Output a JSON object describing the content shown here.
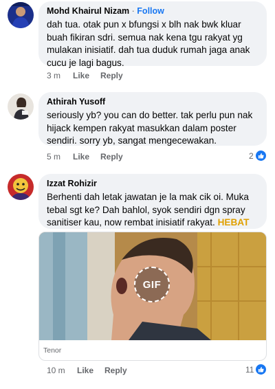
{
  "comments": [
    {
      "author": "Mohd Khairul Nizam",
      "separator": "·",
      "follow_label": "Follow",
      "text_lines": [
        "dah tua. otak pun x bfungsi x blh nak bwk kluar",
        "buah fikiran sdri. semua nak kena tgu rakyat yg",
        "mulakan inisiatif. dah tua duduk rumah jaga anak",
        "cucu je lagi bagus."
      ],
      "time": "3 m",
      "like_label": "Like",
      "reply_label": "Reply"
    },
    {
      "author": "Athirah Yusoff",
      "text_lines": [
        "seriously yb? you can do better. tak perlu pun nak",
        "hijack kempen rakyat masukkan dalam poster",
        "sendiri. sorry yb, sangat mengecewakan."
      ],
      "time": "5 m",
      "like_label": "Like",
      "reply_label": "Reply",
      "reaction_count": "2"
    },
    {
      "author": "Izzat Rohizir",
      "text_lines": [
        "Berhenti dah letak jawatan je la mak cik oi. Muka",
        "tebal sgt ke? Dah bahlol, syok sendiri dgn spray"
      ],
      "text_line3_prefix": "sanitiser kau, now rembat inisiatif rakyat. ",
      "text_line3_highlight": "HEBAT",
      "gif_badge": "GIF",
      "gif_source": "Tenor",
      "time": "10 m",
      "like_label": "Like",
      "reply_label": "Reply",
      "reaction_count": "11"
    }
  ],
  "colors": {
    "bubble": "#f0f2f5",
    "link_blue": "#1877f2",
    "muted": "#65676b",
    "highlight": "#e0a000"
  }
}
